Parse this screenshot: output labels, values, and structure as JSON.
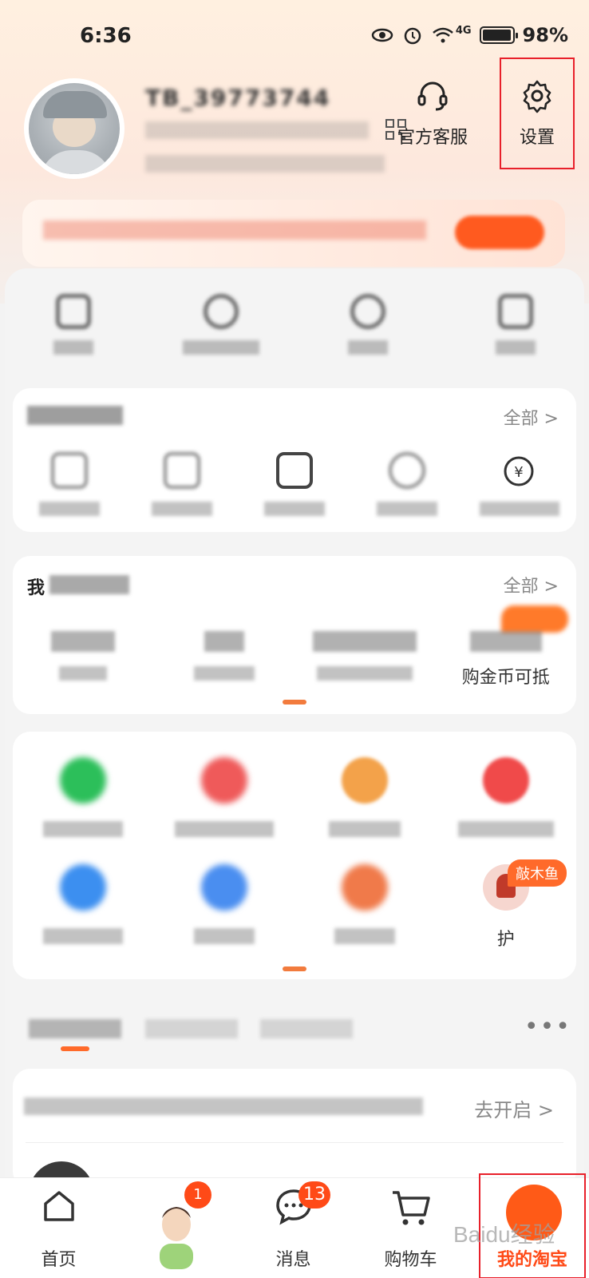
{
  "status_bar": {
    "time": "6:36",
    "network": "4G",
    "battery": "98%",
    "battery_level": 0.98
  },
  "profile": {
    "username": "TB_39773744",
    "sub_line": "",
    "stats_line": "",
    "customer_service": "官方客服",
    "settings": "设置"
  },
  "banner": {
    "text": "",
    "button": ""
  },
  "quick_links": [
    {
      "label": ""
    },
    {
      "label": ""
    },
    {
      "label": ""
    },
    {
      "label": ""
    }
  ],
  "orders": {
    "title": "",
    "more": "全部 >",
    "items": [
      {
        "label": ""
      },
      {
        "label": ""
      },
      {
        "label": ""
      },
      {
        "label": ""
      },
      {
        "label": ""
      }
    ]
  },
  "assets": {
    "title": "我",
    "more": "全部 >",
    "items": [
      {
        "value": "",
        "label": ""
      },
      {
        "value": "",
        "label": ""
      },
      {
        "value": "",
        "label": ""
      },
      {
        "value": "",
        "label": "购金币可抵"
      }
    ]
  },
  "services": {
    "row1": [
      {
        "label": ""
      },
      {
        "label": ""
      },
      {
        "label": ""
      },
      {
        "label": ""
      }
    ],
    "row2": [
      {
        "label": ""
      },
      {
        "label": ""
      },
      {
        "label": ""
      },
      {
        "label": "护"
      }
    ],
    "badge": "敲木鱼"
  },
  "feed_tabs": {
    "tab1": "",
    "tab2": "",
    "tab3": "",
    "more": "•••"
  },
  "notify": {
    "text": "",
    "action": "去开启 >",
    "name": ""
  },
  "bottom_nav": {
    "home": "首页",
    "message": "消息",
    "cart": "购物车",
    "mine": "我的淘宝",
    "avatar_badge": "1",
    "message_badge": "13"
  },
  "watermark": "Baidu经验",
  "colors": {
    "accent": "#ff5a17",
    "highlight_box": "#e8202a"
  }
}
